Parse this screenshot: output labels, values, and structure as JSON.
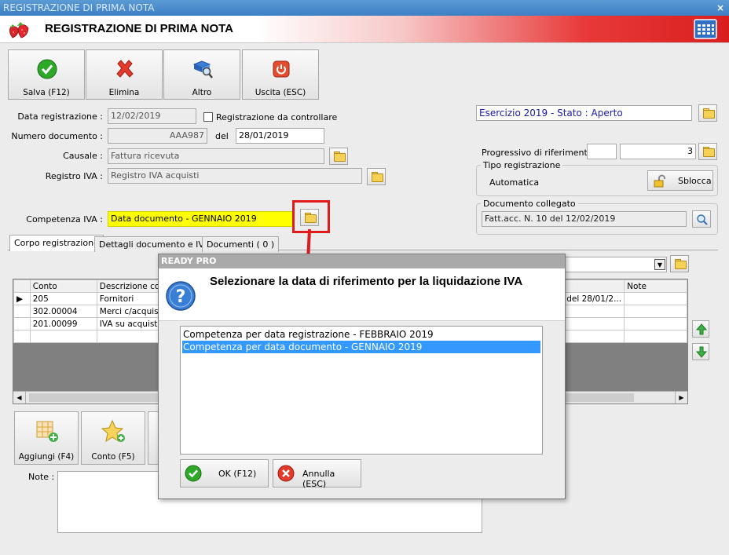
{
  "window": {
    "title": "REGISTRAZIONE DI PRIMA NOTA",
    "close_glyph": "×"
  },
  "header": {
    "title": "REGISTRAZIONE DI PRIMA NOTA"
  },
  "toolbar": {
    "save_label": "Salva (F12)",
    "delete_label": "Elimina",
    "other_label": "Altro",
    "exit_label": "Uscita (ESC)"
  },
  "form": {
    "data_registrazione_label": "Data registrazione :",
    "data_registrazione_value": "12/02/2019",
    "da_controllare_label": "Registrazione da controllare",
    "numero_documento_label": "Numero documento :",
    "numero_documento_value": "AAA987",
    "del_label": "del",
    "del_value": "28/01/2019",
    "causale_label": "Causale :",
    "causale_value": "Fattura ricevuta",
    "registro_iva_label": "Registro IVA :",
    "registro_iva_value": "Registro IVA acquisti",
    "competenza_iva_label": "Competenza IVA :",
    "competenza_iva_value": "Data documento - GENNAIO 2019"
  },
  "right": {
    "esercizio": "Esercizio 2019 - Stato : Aperto",
    "progressivo_label": "Progressivo di riferimento :",
    "progressivo_value": "3",
    "tipo_registrazione_title": "Tipo registrazione",
    "tipo_registrazione_value": "Automatica",
    "sblocca_label": "Sblocca",
    "documento_collegato_title": "Documento collegato",
    "documento_collegato_value": "Fatt.acc. N. 10 del 12/02/2019"
  },
  "tabs": [
    {
      "label": "Corpo registrazione"
    },
    {
      "label": "Dettagli documento e IVA"
    },
    {
      "label": "Documenti ( 0 )"
    }
  ],
  "grid": {
    "columns": [
      "Conto",
      "Descrizione con",
      "Note"
    ],
    "rows": [
      {
        "conto": "205",
        "descr": "Fornitori",
        "extra": "87 del 28/01/2..."
      },
      {
        "conto": "302.00004",
        "descr": "Merci c/acquisti",
        "extra": ""
      },
      {
        "conto": "201.00099",
        "descr": "IVA su acquisti",
        "extra": ""
      }
    ]
  },
  "bottom": {
    "aggiungi_label": "Aggiungi (F4)",
    "conto_label": "Conto (F5)",
    "note_label": "Note :"
  },
  "dialog": {
    "title": "READY PRO",
    "message": "Selezionare la data di riferimento per la liquidazione IVA",
    "options": [
      "Competenza per data registrazione - FEBBRAIO 2019",
      "Competenza per data documento - GENNAIO 2019"
    ],
    "selected_index": 1,
    "ok_label": "OK (F12)",
    "cancel_label": "Annulla (ESC)"
  },
  "colors": {
    "highlight_yellow": "#ffff00",
    "selection_blue": "#3399ff",
    "annotation_red": "#e01b1b",
    "esercizio_text": "#1a1aa6"
  }
}
